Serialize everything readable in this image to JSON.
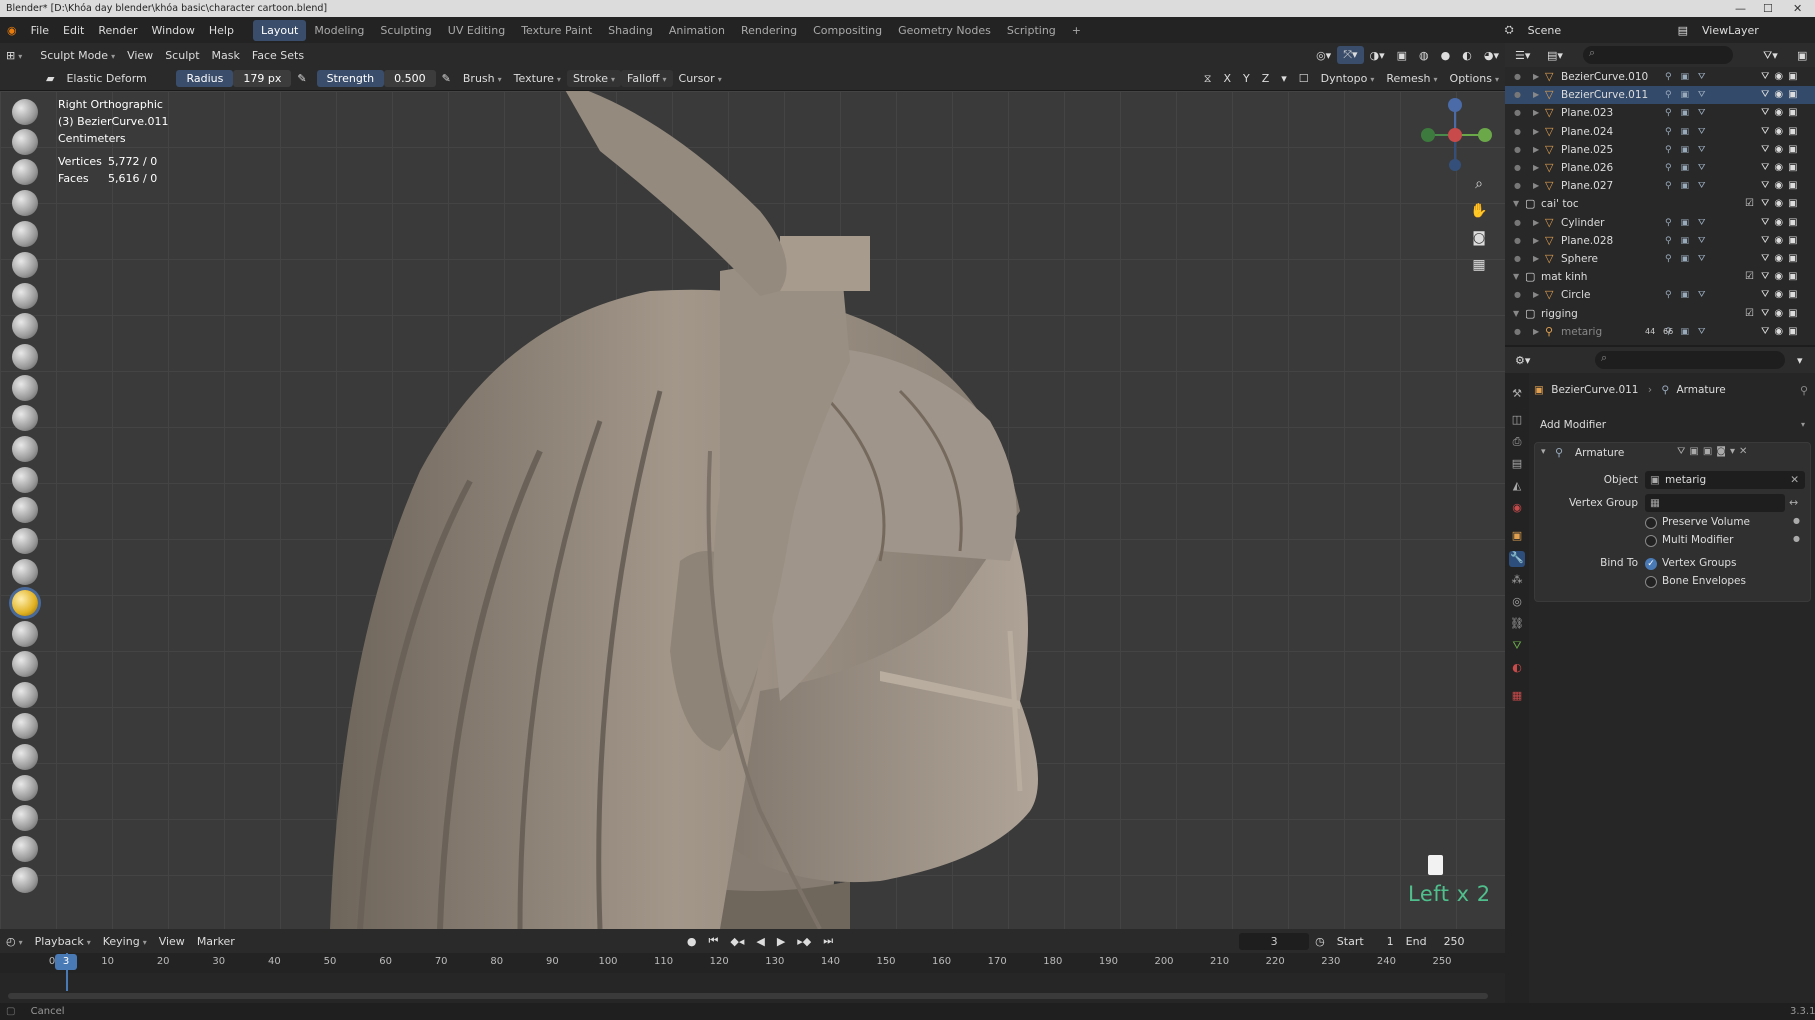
{
  "window": {
    "title": "Blender* [D:\\Khóa day blender\\khóa basic\\character cartoon.blend]",
    "version": "3.3.1"
  },
  "menu": [
    "File",
    "Edit",
    "Render",
    "Window",
    "Help"
  ],
  "workspaces": [
    {
      "label": "Layout",
      "active": true
    },
    {
      "label": "Modeling"
    },
    {
      "label": "Sculpting"
    },
    {
      "label": "UV Editing"
    },
    {
      "label": "Texture Paint"
    },
    {
      "label": "Shading"
    },
    {
      "label": "Animation"
    },
    {
      "label": "Rendering"
    },
    {
      "label": "Compositing"
    },
    {
      "label": "Geometry Nodes"
    },
    {
      "label": "Scripting"
    }
  ],
  "scene": {
    "label": "Scene",
    "view_layer": "ViewLayer"
  },
  "header2": {
    "mode": "Sculpt Mode",
    "items": [
      "View",
      "Sculpt",
      "Mask",
      "Face Sets"
    ]
  },
  "tool_header": {
    "brush_name": "Elastic Deform",
    "radius_label": "Radius",
    "radius_value": "179 px",
    "strength_label": "Strength",
    "strength_value": "0.500",
    "dropdowns": [
      "Brush",
      "Texture",
      "Stroke",
      "Falloff",
      "Cursor"
    ],
    "axes": [
      "X",
      "Y",
      "Z"
    ],
    "dyntopo": "Dyntopo",
    "remesh": "Remesh",
    "options": "Options"
  },
  "overlay": {
    "view": "Right Orthographic",
    "object": "(3) BezierCurve.011",
    "units": "Centimeters",
    "vertices_label": "Vertices",
    "vertices_value": "5,772 / 0",
    "faces_label": "Faces",
    "faces_value": "5,616 / 0"
  },
  "keystroke": "Left x 2",
  "outliner": {
    "rows": [
      {
        "name": "BezierCurve.010",
        "type": "object"
      },
      {
        "name": "BezierCurve.011",
        "type": "object",
        "selected": true
      },
      {
        "name": "Plane.023",
        "type": "object"
      },
      {
        "name": "Plane.024",
        "type": "object"
      },
      {
        "name": "Plane.025",
        "type": "object"
      },
      {
        "name": "Plane.026",
        "type": "object"
      },
      {
        "name": "Plane.027",
        "type": "object"
      },
      {
        "name": "cai' toc",
        "type": "collection"
      },
      {
        "name": "Cylinder",
        "type": "object"
      },
      {
        "name": "Plane.028",
        "type": "object"
      },
      {
        "name": "Sphere",
        "type": "object"
      },
      {
        "name": "mat kinh",
        "type": "collection"
      },
      {
        "name": "Circle",
        "type": "object"
      },
      {
        "name": "rigging",
        "type": "collection"
      },
      {
        "name": "metarig",
        "type": "armature",
        "dimmed": true,
        "badges": [
          "44",
          "66"
        ]
      }
    ]
  },
  "properties": {
    "breadcrumb_object": "BezierCurve.011",
    "breadcrumb_modifier": "Armature",
    "add_modifier": "Add Modifier",
    "modifier_name": "Armature",
    "object_label": "Object",
    "object_value": "metarig",
    "vertex_group_label": "Vertex Group",
    "preserve_volume": "Preserve Volume",
    "multi_modifier": "Multi Modifier",
    "bind_to_label": "Bind To",
    "vertex_groups": "Vertex Groups",
    "bone_envelopes": "Bone Envelopes"
  },
  "timeline": {
    "menus": [
      "Playback",
      "Keying",
      "View",
      "Marker"
    ],
    "current_frame": "3",
    "start_label": "Start",
    "start": "1",
    "end_label": "End",
    "end": "250",
    "ticks": [
      "0",
      "10",
      "20",
      "30",
      "40",
      "50",
      "60",
      "70",
      "80",
      "90",
      "100",
      "110",
      "120",
      "130",
      "140",
      "150",
      "160",
      "170",
      "180",
      "190",
      "200",
      "210",
      "220",
      "230",
      "240",
      "250"
    ]
  },
  "status": {
    "left": "Cancel"
  },
  "colors": {
    "accent": "#4a7ab6",
    "keystroke": "#4fc08d",
    "clay": "#9a8e80"
  }
}
